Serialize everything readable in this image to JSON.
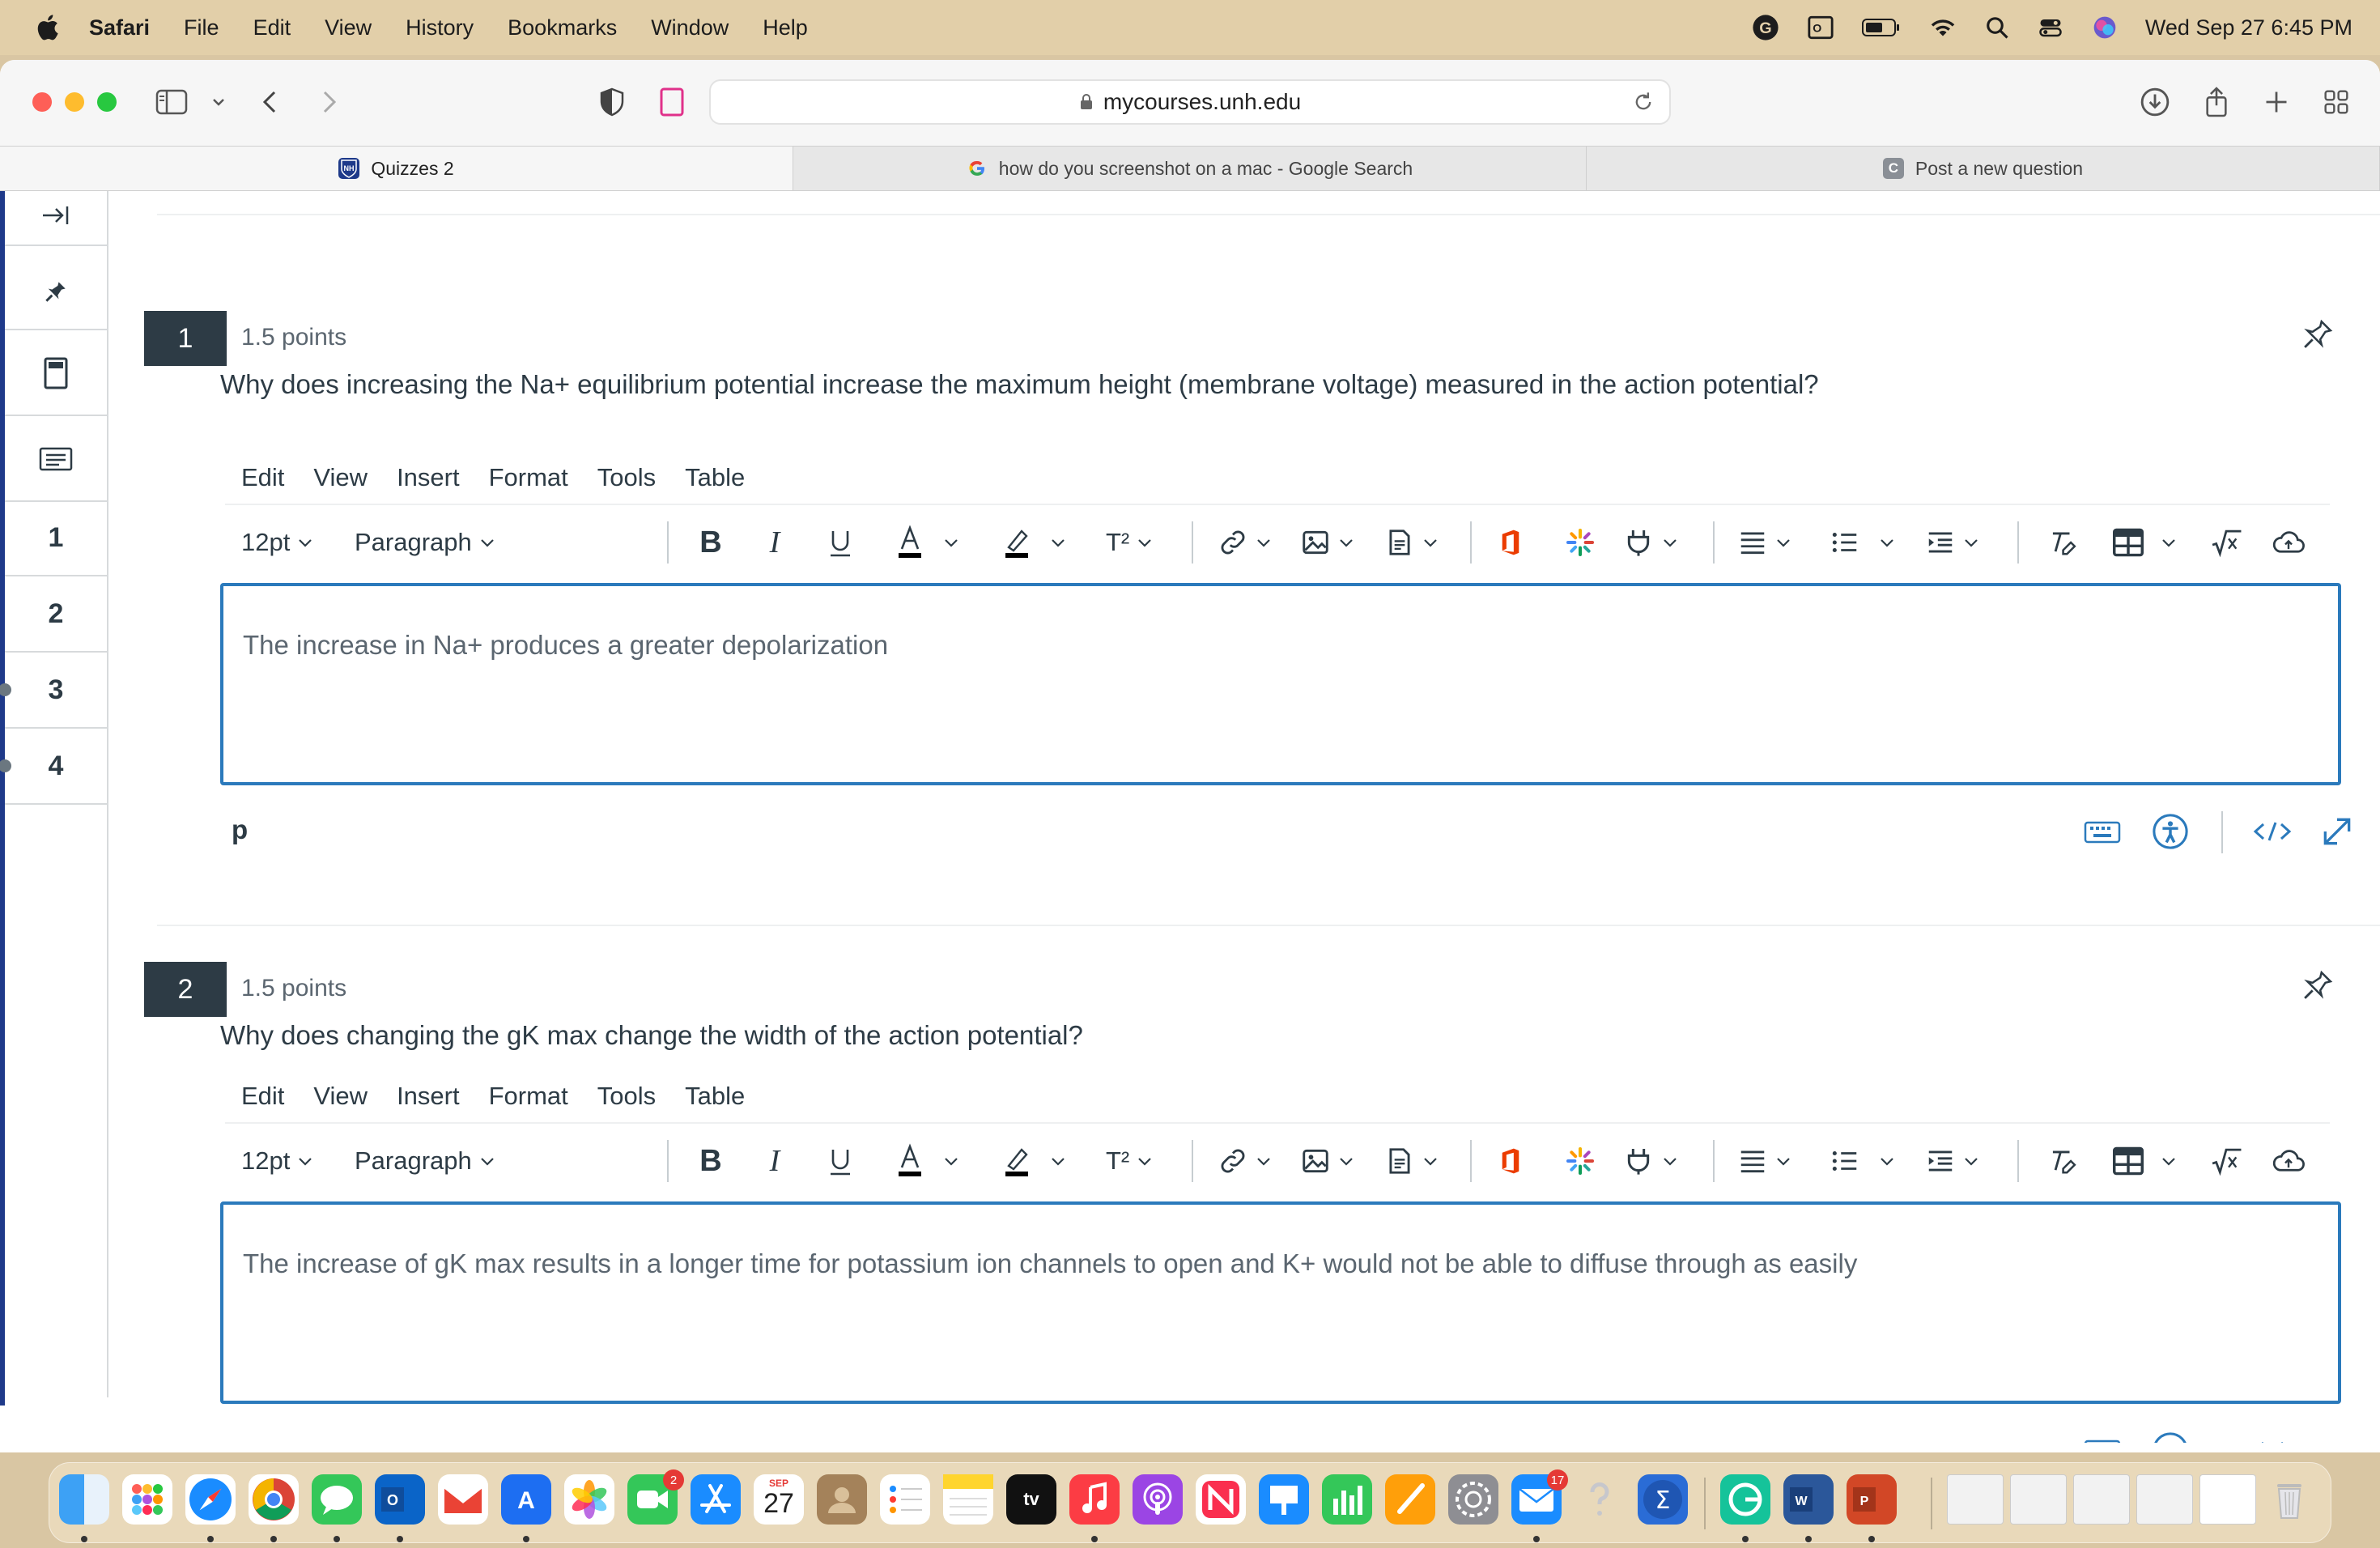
{
  "menubar": {
    "app": "Safari",
    "items": [
      "File",
      "Edit",
      "View",
      "History",
      "Bookmarks",
      "Window",
      "Help"
    ],
    "clock": "Wed Sep 27  6:45 PM"
  },
  "browser": {
    "url": "mycourses.unh.edu",
    "tabs": [
      {
        "label": "Quizzes 2",
        "icon": "unh-shield-icon"
      },
      {
        "label": "how do you screenshot on a mac - Google Search",
        "icon": "google-icon"
      },
      {
        "label": "Post a new question",
        "icon": "c-icon",
        "icon_letter": "C"
      }
    ]
  },
  "sidebar": {
    "questions": [
      "1",
      "2",
      "3",
      "4"
    ]
  },
  "editor": {
    "menu": [
      "Edit",
      "View",
      "Insert",
      "Format",
      "Tools",
      "Table"
    ],
    "font_size": "12pt",
    "block_format": "Paragraph",
    "superscript_label": "T²",
    "status_path": "p"
  },
  "questions": [
    {
      "number": "1",
      "points": "1.5 points",
      "text": "Why does increasing the Na+ equilibrium potential increase the maximum height (membrane voltage) measured in the action potential?",
      "answer": "The increase in Na+ produces a greater depolarization"
    },
    {
      "number": "2",
      "points": "1.5 points",
      "text": "Why does changing the gK max change the width of the action potential?",
      "answer": "The increase of gK max results in a longer time for potassium ion channels to open and K+ would not be able to diffuse through as easily"
    }
  ],
  "dock": {
    "calendar_month": "SEP",
    "calendar_day": "27",
    "badges": {
      "facetime": "2",
      "mail": "17"
    },
    "tv_label": "tv"
  },
  "colors": {
    "menubar": "#e2cfa9",
    "question_badge": "#2d3b45",
    "editor_border": "#2b7abc",
    "text": "#2d3b45"
  }
}
